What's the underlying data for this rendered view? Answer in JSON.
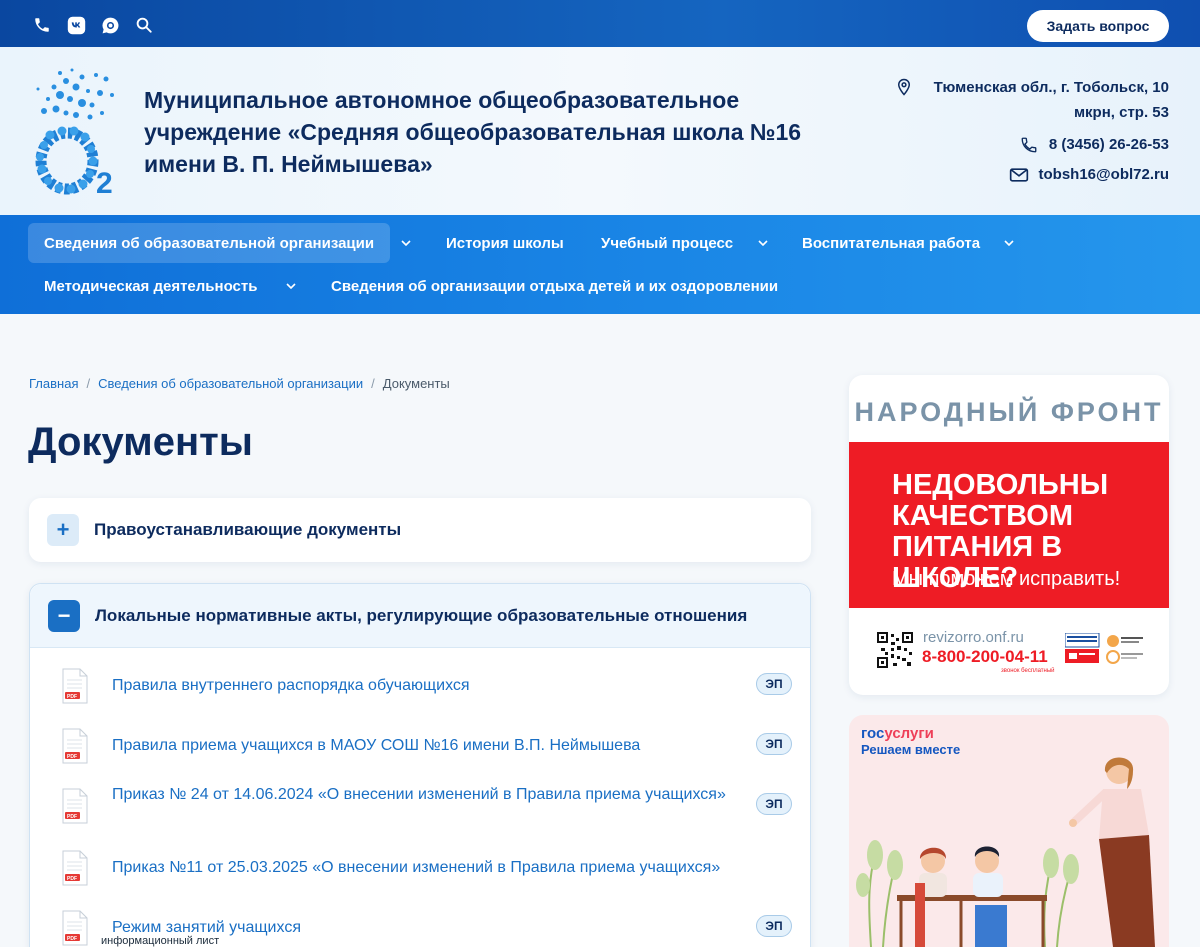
{
  "topbar": {
    "icons": [
      "phone-icon",
      "vk-icon",
      "chat-icon",
      "search-icon"
    ],
    "ask_label": "Задать вопрос"
  },
  "header": {
    "org_name": "Муниципальное автономное общеобразовательное учреждение «Средняя общеобразовательная школа №16 имени В. П. Неймышева»",
    "address": "Тюменская обл., г. Тобольск, 10 мкрн, стр. 53",
    "phone": "8 (3456) 26-26-53",
    "email": "tobsh16@obl72.ru"
  },
  "nav": {
    "items": [
      {
        "label": "Сведения об образовательной организации",
        "active": true,
        "has_submenu": true
      },
      {
        "label": "История школы",
        "has_submenu": false
      },
      {
        "label": "Учебный процесс",
        "has_submenu": true
      },
      {
        "label": "Воспитательная работа",
        "has_submenu": true
      },
      {
        "label": "Методическая деятельность",
        "has_submenu": true
      },
      {
        "label": "Сведения об организации отдыха детей и их оздоровлении",
        "has_submenu": false
      }
    ]
  },
  "breadcrumb": {
    "home": "Главная",
    "section": "Сведения об образовательной организации",
    "current": "Документы"
  },
  "page": {
    "title": "Документы"
  },
  "accordion": [
    {
      "title": "Правоустанавливающие документы",
      "expanded": false,
      "toggle": "+"
    },
    {
      "title": "Локальные нормативные акты, регулирующие образовательные отношения",
      "expanded": true,
      "toggle": "−",
      "documents": [
        {
          "title": "Правила внутреннего распорядка обучающихся",
          "badge": "ЭП"
        },
        {
          "title": "Правила приема учащихся в МАОУ СОШ №16 имени В.П. Неймышева",
          "badge": "ЭП"
        },
        {
          "title": "Приказ № 24 от 14.06.2024 «О внесении изменений в Правила приема учащихся»",
          "badge": "ЭП"
        },
        {
          "title": "Приказ №11 от 25.03.2025 «О внесении изменений в Правила приема учащихся»",
          "badge": ""
        },
        {
          "title": "Режим занятий учащихся",
          "badge": "ЭП"
        }
      ]
    }
  ],
  "partial_text": "информационный лист",
  "banners": {
    "onf": {
      "heading": "НАРОДНЫЙ ФРОНТ",
      "main": "НЕДОВОЛЬНЫ КАЧЕСТВОМ ПИТАНИЯ В ШКОЛЕ?",
      "sub": "Мы поможем исправить!",
      "url": "revizorro.onf.ru",
      "phone": "8-800-200-04-11",
      "note": "звонок бесплатный"
    },
    "gosuslugi": {
      "logo_a": "гос",
      "logo_b": "услуги",
      "tagline": "Решаем вместе"
    }
  },
  "colors": {
    "primary": "#0d2b5e",
    "accent": "#1a6fc4",
    "red": "#ee1c25"
  }
}
